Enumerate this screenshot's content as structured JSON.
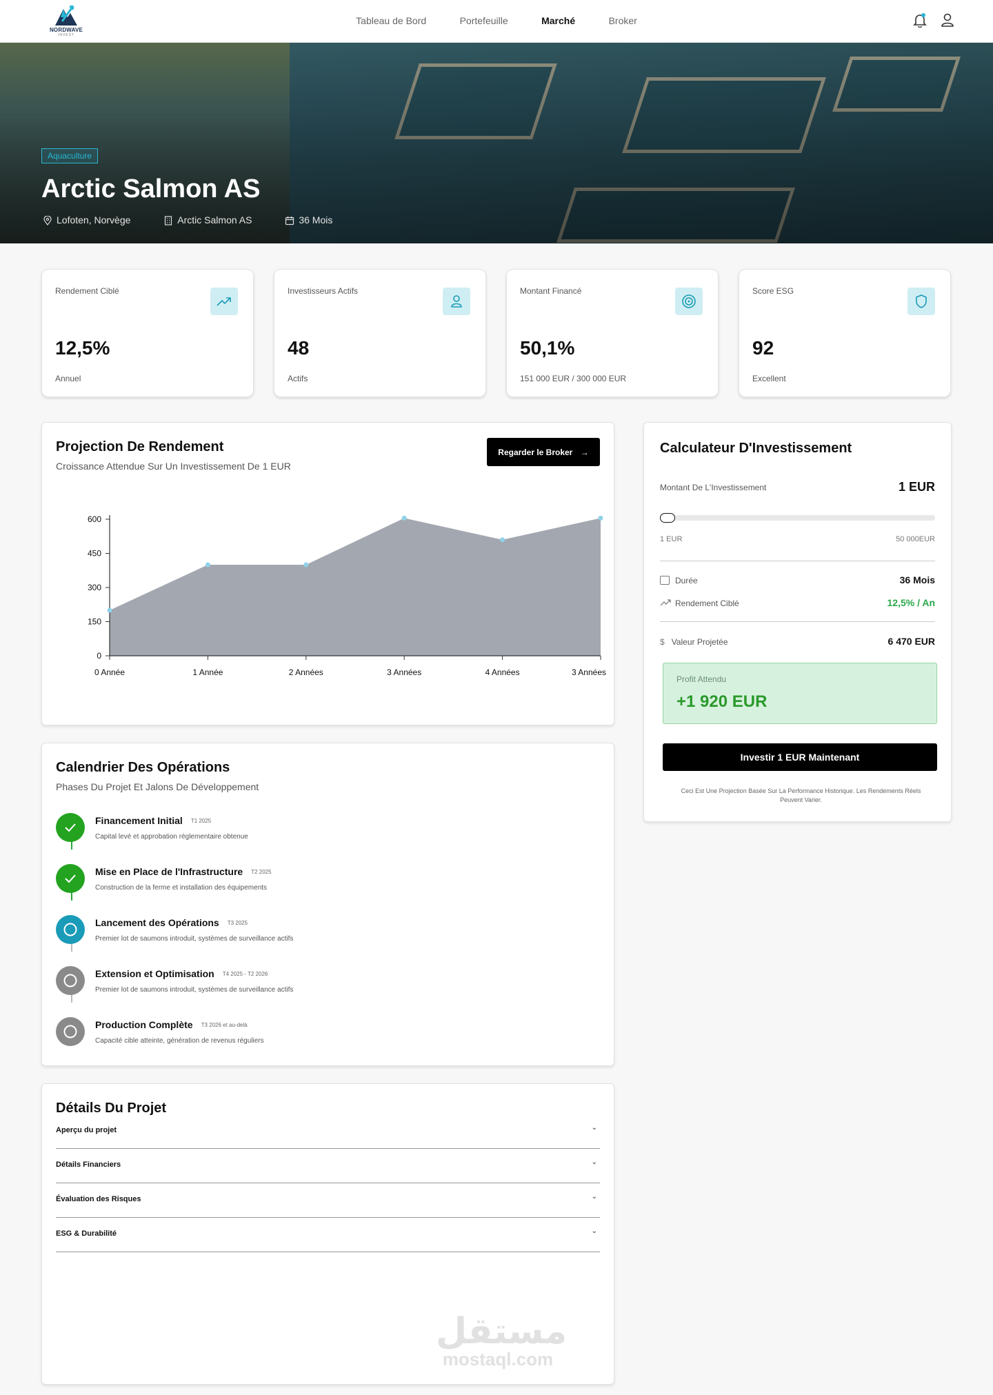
{
  "nav": {
    "brand": "NORDWAVE",
    "brand_sub": "INVEST",
    "links": [
      {
        "label": "Tableau de Bord",
        "active": false
      },
      {
        "label": "Portefeuille",
        "active": false
      },
      {
        "label": "Marché",
        "active": true
      },
      {
        "label": "Broker",
        "active": false
      }
    ],
    "icons": [
      "bell-icon",
      "user-icon"
    ]
  },
  "hero": {
    "tag": "Aquaculture",
    "title": "Arctic Salmon AS",
    "location": "Lofoten, Norvège",
    "company": "Arctic Salmon AS",
    "duration": "36 Mois"
  },
  "stats": [
    {
      "label": "Rendement Ciblé",
      "value": "12,5%",
      "sub": "Annuel",
      "icon": "trending-up-icon"
    },
    {
      "label": "Investisseurs Actifs",
      "value": "48",
      "sub": "Actifs",
      "icon": "user-icon"
    },
    {
      "label": "Montant Financé",
      "value": "50,1%",
      "sub": "151 000 EUR / 300 000 EUR",
      "icon": "target-icon"
    },
    {
      "label": "Score ESG",
      "value": "92",
      "sub": "Excellent",
      "icon": "shield-icon"
    }
  ],
  "projection": {
    "title": "Projection De Rendement",
    "subtitle": "Croissance Attendue Sur Un Investissement De 1 EUR",
    "button": "Regarder le Broker"
  },
  "chart_data": {
    "type": "area",
    "categories": [
      "0 Année",
      "1 Année",
      "2 Années",
      "3 Années",
      "4 Années",
      "3 Années"
    ],
    "values": [
      200,
      400,
      400,
      605,
      510,
      605
    ],
    "yticks": [
      0,
      150,
      300,
      450,
      600
    ],
    "ylim": [
      0,
      600
    ],
    "fill_color": "#a3a7b0",
    "point_color": "#8fd3ea",
    "grid": false
  },
  "calculator": {
    "title": "Calculateur D'Investissement",
    "amount_label": "Montant De L'Investissement",
    "amount_value": "1 EUR",
    "slider_min": "1 EUR",
    "slider_max": "50 000EUR",
    "duration_label": "Durée",
    "duration_value": "36 Mois",
    "yield_label": "Rendement Ciblé",
    "yield_value": "12,5% / An",
    "projected_label": "Valeur Projetée",
    "projected_value": "6 470 EUR",
    "profit_label": "Profit Attendu",
    "profit_value": "+1 920 EUR",
    "invest_button": "Investir 1 EUR Maintenant",
    "disclaimer": "Ceci Est Une Projection Basée Sur La Performance Historique. Les Rendements Réels Peuvent Varier."
  },
  "timeline": {
    "title": "Calendrier Des Opérations",
    "subtitle": "Phases Du Projet Et Jalons De Développement",
    "steps": [
      {
        "title": "Financement Initial",
        "when": "T1 2025",
        "desc": "Capital levé et approbation réglementaire obtenue",
        "status": "done"
      },
      {
        "title": "Mise en Place de l'Infrastructure",
        "when": "T2 2025",
        "desc": "Construction de la ferme et installation des équipements",
        "status": "done"
      },
      {
        "title": "Lancement des Opérations",
        "when": "T3 2025",
        "desc": "Premier lot de saumons introduit, systèmes de surveillance actifs",
        "status": "active"
      },
      {
        "title": "Extension et Optimisation",
        "when": "T4 2025 - T2 2026",
        "desc": "Premier lot de saumons introduit, systèmes de surveillance actifs",
        "status": "pending"
      },
      {
        "title": "Production Complète",
        "when": "T3 2026 et au-delà",
        "desc": "Capacité cible atteinte, génération de revenus réguliers",
        "status": "pending"
      }
    ]
  },
  "details": {
    "title": "Détails Du Projet",
    "items": [
      "Aperçu du projet",
      "Détails Financiers",
      "Évaluation des Risques",
      "ESG & Durabilité"
    ]
  },
  "watermark": {
    "arabic": "مستقل",
    "latin": "mostaql.com"
  }
}
